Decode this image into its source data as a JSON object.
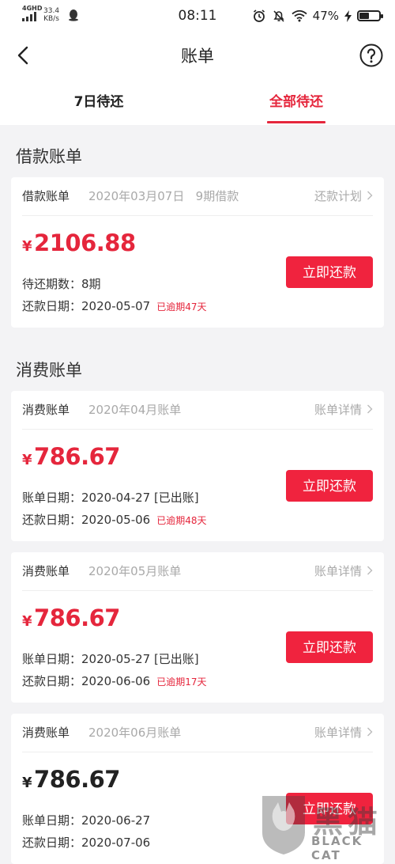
{
  "status_bar": {
    "network": "4GHD",
    "speed": "33.4",
    "speed_unit": "KB/s",
    "time": "08:11",
    "battery": "47%",
    "battery_level": 0.47
  },
  "header": {
    "title": "账单",
    "back_icon": "chevron-left-icon",
    "help_icon": "question-circle-icon"
  },
  "tabs": [
    {
      "label": "7日待还",
      "active": false
    },
    {
      "label": "全部待还",
      "active": true
    }
  ],
  "sections": {
    "loan_title": "借款账单",
    "consume_title": "消费账单"
  },
  "loan_bill": {
    "type": "借款账单",
    "date": "2020年03月07日",
    "term": "9期借款",
    "link": "还款计划",
    "currency": "¥",
    "amount": "2106.88",
    "periods_label": "待还期数：",
    "periods_value": "8期",
    "due_label": "还款日期：",
    "due_value": "2020-05-07",
    "overdue": "已逾期47天",
    "button": "立即还款"
  },
  "consume_bills": [
    {
      "type": "消费账单",
      "month": "2020年04月账单",
      "link": "账单详情",
      "currency": "¥",
      "amount": "786.67",
      "bill_label": "账单日期：",
      "bill_value": "2020-04-27 [已出账]",
      "due_label": "还款日期：",
      "due_value": "2020-05-06",
      "overdue": "已逾期48天",
      "button": "立即还款"
    },
    {
      "type": "消费账单",
      "month": "2020年05月账单",
      "link": "账单详情",
      "currency": "¥",
      "amount": "786.67",
      "bill_label": "账单日期：",
      "bill_value": "2020-05-27 [已出账]",
      "due_label": "还款日期：",
      "due_value": "2020-06-06",
      "overdue": "已逾期17天",
      "button": "立即还款"
    },
    {
      "type": "消费账单",
      "month": "2020年06月账单",
      "link": "账单详情",
      "currency": "¥",
      "amount": "786.67",
      "bill_label": "账单日期：",
      "bill_value": "2020-06-27",
      "due_label": "还款日期：",
      "due_value": "2020-07-06",
      "button": "立即还款"
    }
  ],
  "watermark": {
    "text_cn": "黑猫",
    "text_en": "BLACK CAT"
  },
  "colors": {
    "accent": "#e5263c",
    "button": "#f0233e",
    "background": "#f3f3f5"
  }
}
